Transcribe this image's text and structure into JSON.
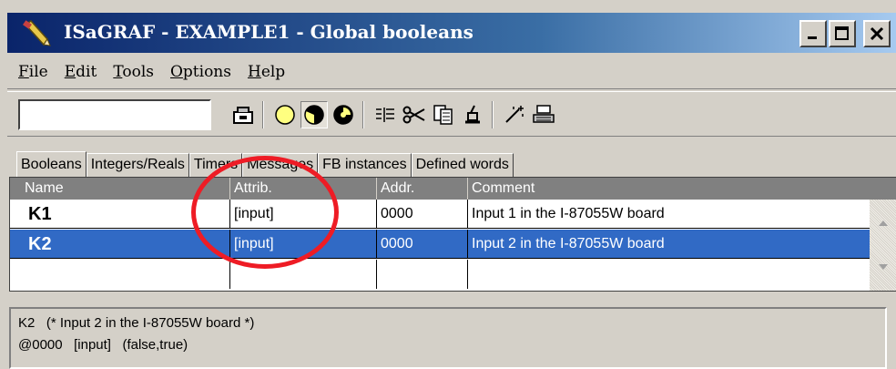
{
  "window": {
    "title": "ISaGRAF - EXAMPLE1 - Global booleans",
    "icon": "pencil-icon",
    "controls": {
      "minimize": "_",
      "maximize": "□",
      "close": "×"
    }
  },
  "menu": [
    "File",
    "Edit",
    "Tools",
    "Options",
    "Help"
  ],
  "toolbar": {
    "input_value": "",
    "buttons": [
      "save-icon",
      "circle-empty-icon",
      "circle-half-icon",
      "circle-quarter-icon",
      "list-icon",
      "scissors-icon",
      "copy-icon",
      "paste-icon",
      "wand-icon",
      "printer-icon"
    ]
  },
  "tabs": [
    "Booleans",
    "Integers/Reals",
    "Timers",
    "Messages",
    "FB instances",
    "Defined words"
  ],
  "grid": {
    "columns": [
      "Name",
      "Attrib.",
      "Addr.",
      "Comment"
    ],
    "rows": [
      {
        "name": "K1",
        "attrib": "[input]",
        "addr": "0000",
        "comment": "Input 1 in the I-87055W board"
      },
      {
        "name": "K2",
        "attrib": "[input]",
        "addr": "0000",
        "comment": "Input 2 in the I-87055W board"
      }
    ],
    "selected_row": 1
  },
  "status": {
    "line1": "K2   (* Input 2 in the I-87055W board *)",
    "line2": "@0000   [input]   (false,true)"
  },
  "colors": {
    "title_start": "#0a246a",
    "title_end": "#a6caf0",
    "selection": "#316ac5",
    "annotation": "#ee1c25"
  }
}
